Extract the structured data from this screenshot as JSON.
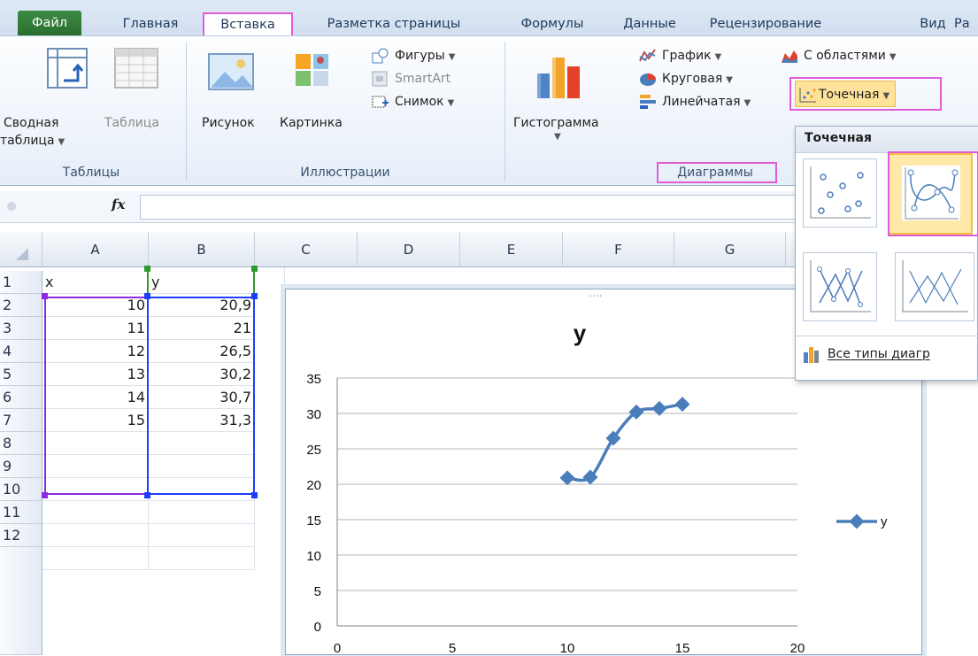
{
  "tabs": [
    {
      "label": "Файл"
    },
    {
      "label": "Главная"
    },
    {
      "label": "Вставка"
    },
    {
      "label": "Разметка страницы"
    },
    {
      "label": "Формулы"
    },
    {
      "label": "Данные"
    },
    {
      "label": "Рецензирование"
    },
    {
      "label": "Вид"
    },
    {
      "label": "Ра"
    }
  ],
  "ribbon": {
    "tables": {
      "group_label": "Таблицы",
      "pivot_line1": "Сводная",
      "pivot_line2": "таблица",
      "table": "Таблица"
    },
    "illustrations": {
      "group_label": "Иллюстрации",
      "picture": "Рисунок",
      "clipart": "Картинка",
      "shapes": "Фигуры",
      "smartart": "SmartArt",
      "screenshot": "Снимок"
    },
    "charts": {
      "group_label": "Диаграммы",
      "column": "Гистограмма",
      "line": "График",
      "pie": "Круговая",
      "bar": "Линейчатая",
      "area": "С областями",
      "scatter": "Точечная"
    }
  },
  "formula_bar": {
    "fx": "fx",
    "value": ""
  },
  "columns": [
    "A",
    "B",
    "C",
    "D",
    "E",
    "F",
    "G"
  ],
  "rows": [
    "1",
    "2",
    "3",
    "4",
    "5",
    "6",
    "7",
    "8",
    "9",
    "10",
    "11",
    "12"
  ],
  "cells": {
    "a1": "x",
    "b1": "y",
    "x_values": [
      "10",
      "11",
      "12",
      "13",
      "14",
      "15"
    ],
    "y_values": [
      "20,9",
      "21",
      "26,5",
      "30,2",
      "30,7",
      "31,3"
    ]
  },
  "gallery": {
    "title": "Точечная",
    "all_types": "Все типы диагр"
  },
  "chart_data": {
    "type": "scatter",
    "title": "y",
    "series": [
      {
        "name": "y",
        "x": [
          10,
          11,
          12,
          13,
          14,
          15
        ],
        "y": [
          20.9,
          21,
          26.5,
          30.2,
          30.7,
          31.3
        ]
      }
    ],
    "xlim": [
      0,
      20
    ],
    "ylim": [
      0,
      35
    ],
    "x_ticks": [
      0,
      5,
      10,
      15,
      20
    ],
    "y_ticks": [
      0,
      5,
      10,
      15,
      20,
      25,
      30,
      35
    ],
    "grid": true,
    "legend": "right",
    "color": "#4a7ebb"
  },
  "colors": {
    "accent_pink": "#e15cd8",
    "file_tab": "#2f7a34",
    "selection_blue": "#1f3dff",
    "selection_purple": "#8b2be2"
  }
}
